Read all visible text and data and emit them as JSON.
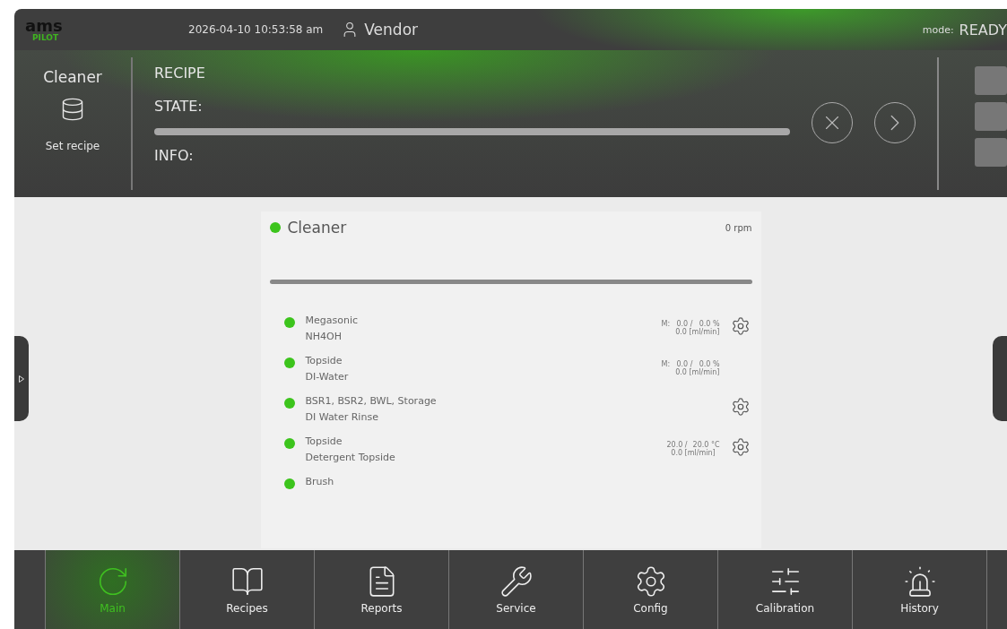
{
  "header": {
    "logo_top": "ams",
    "logo_bottom": "PILOT",
    "datetime": "2026-04-10 10:53:58 am",
    "user": "Vendor",
    "mode_label": "mode:",
    "mode_value": "READY"
  },
  "recipe_panel": {
    "module": "Cleaner",
    "set_recipe": "Set recipe",
    "recipe_label": "RECIPE",
    "state_label": "STATE:",
    "info_label": "INFO:"
  },
  "card": {
    "title": "Cleaner",
    "active": true,
    "speed": "0 rpm",
    "items": [
      {
        "name": "Megasonic",
        "sub": "NH4OH",
        "active": true,
        "prefix": "M:",
        "value": "0.0 /",
        "setpoint": "0.0 %",
        "flow": "0.0 [ml/min]",
        "settings": true
      },
      {
        "name": "Topside",
        "sub": "DI-Water",
        "active": true,
        "prefix": "M:",
        "value": "0.0 /",
        "setpoint": "0.0 %",
        "flow": "0.0 [ml/min]",
        "settings": false
      },
      {
        "name": "BSR1, BSR2, BWL, Storage",
        "sub": "DI Water Rinse",
        "active": true,
        "settings": true
      },
      {
        "name": "Topside",
        "sub": "Detergent Topside",
        "active": true,
        "value": "20.0 /",
        "setpoint": "20.0 °C",
        "flow": "0.0 [ml/min]",
        "settings": true
      },
      {
        "name": "Brush",
        "active": true,
        "settings": false
      }
    ]
  },
  "nav": [
    {
      "kind": "main",
      "label": "Main",
      "selected": true
    },
    {
      "kind": "recipes",
      "label": "Recipes",
      "selected": false
    },
    {
      "kind": "reports",
      "label": "Reports",
      "selected": false
    },
    {
      "kind": "service",
      "label": "Service",
      "selected": false
    },
    {
      "kind": "config",
      "label": "Config",
      "selected": false
    },
    {
      "kind": "calibration",
      "label": "Calibration",
      "selected": false
    },
    {
      "kind": "history",
      "label": "History",
      "selected": false
    }
  ]
}
